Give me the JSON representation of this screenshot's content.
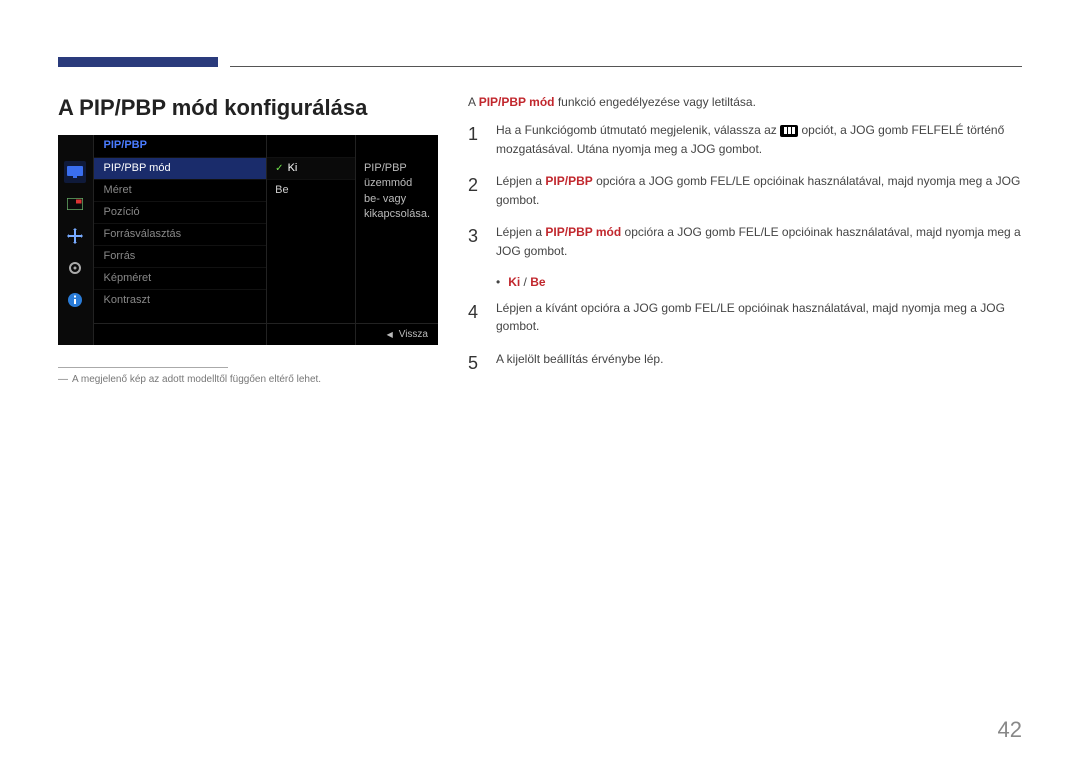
{
  "page": {
    "number": "42",
    "title": "A PIP/PBP mód konfigurálása",
    "footnote": "A megjelenő kép az adott modelltől függően eltérő lehet."
  },
  "osd": {
    "header": "PIP/PBP",
    "menu_items": [
      "PIP/PBP mód",
      "Méret",
      "Pozíció",
      "Forrásválasztás",
      "Forrás",
      "Képméret",
      "Kontraszt"
    ],
    "options": [
      "Ki",
      "Be"
    ],
    "description": "PIP/PBP üzemmód be- vagy kikapcsolása.",
    "back": "Vissza"
  },
  "intro": {
    "prefix": "A ",
    "highlight": "PIP/PBP mód",
    "suffix": " funkció engedélyezése vagy letiltása."
  },
  "steps": {
    "s1": {
      "before_icon": "Ha a Funkciógomb útmutató megjelenik, válassza az ",
      "after_icon": " opciót, a JOG gomb FELFELÉ történő mozgatásával. Utána nyomja meg a JOG gombot."
    },
    "s2": {
      "t1": "Lépjen a ",
      "hl": "PIP/PBP",
      "t2": " opcióra a JOG gomb FEL/LE opcióinak használatával, majd nyomja meg a JOG gombot."
    },
    "s3": {
      "t1": "Lépjen a ",
      "hl": "PIP/PBP mód",
      "t2": " opcióra a JOG gomb FEL/LE opcióinak használatával, majd nyomja meg a JOG gombot."
    },
    "bullet": {
      "hl1": "Ki",
      "sep": " / ",
      "hl2": "Be"
    },
    "s4": "Lépjen a kívánt opcióra a JOG gomb FEL/LE opcióinak használatával, majd nyomja meg a JOG gombot.",
    "s5": "A kijelölt beállítás érvénybe lép."
  }
}
